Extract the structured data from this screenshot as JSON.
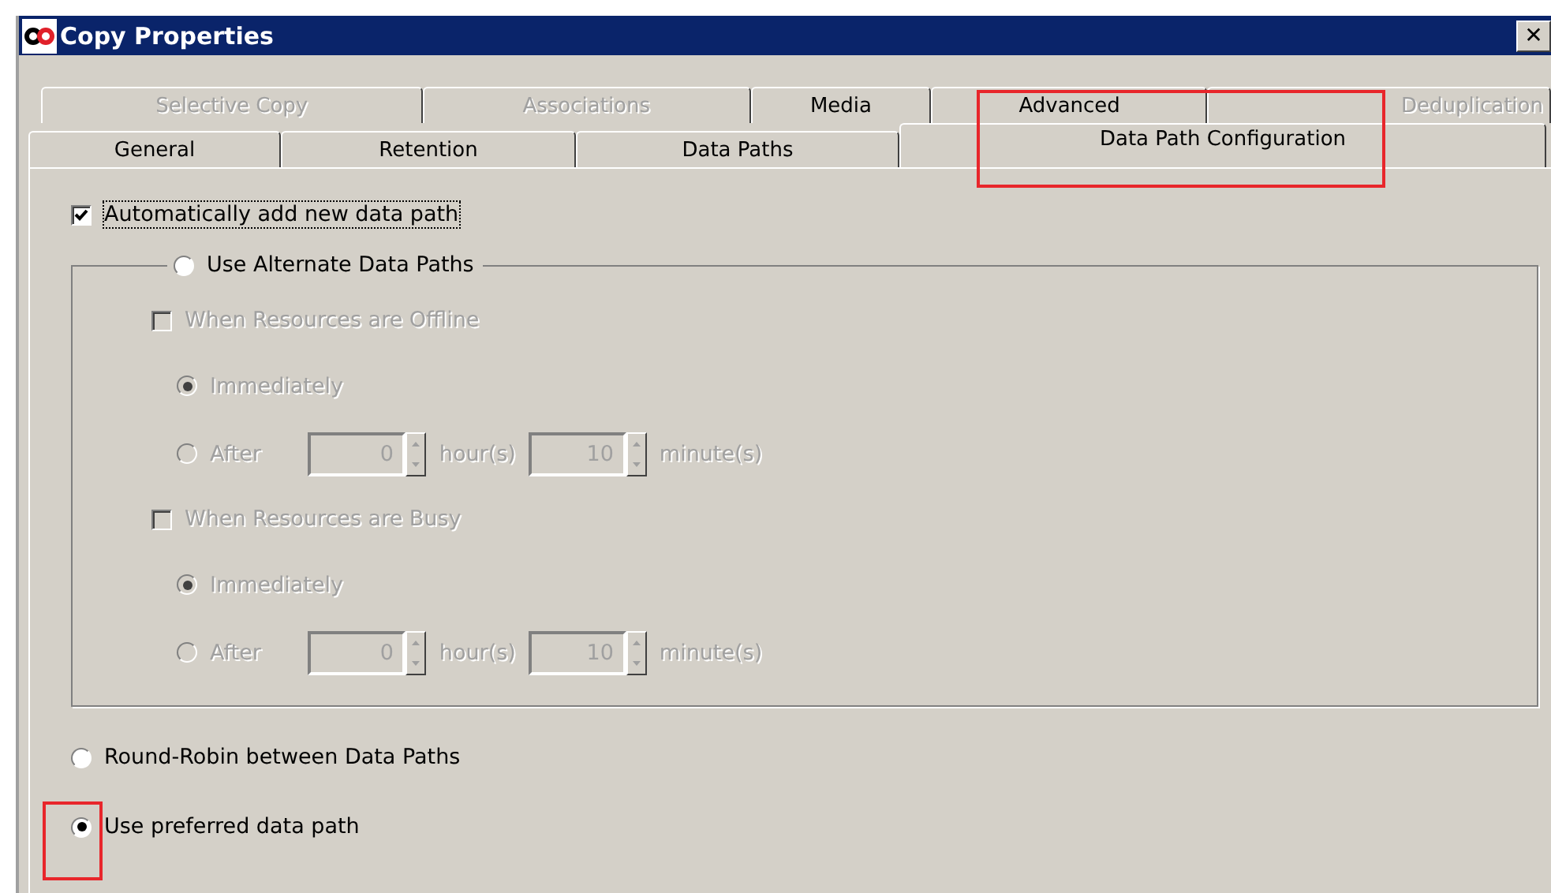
{
  "window": {
    "title": "Copy Properties",
    "close": "✕"
  },
  "tab_rows": [
    [
      {
        "label": "Selective Copy",
        "selected": false,
        "disabled": true
      },
      {
        "label": "Associations",
        "selected": false,
        "disabled": true
      },
      {
        "label": "Media",
        "selected": false,
        "disabled": false
      },
      {
        "label": "Advanced",
        "selected": false,
        "disabled": false
      },
      {
        "label": "Deduplication",
        "selected": false,
        "disabled": true
      }
    ],
    [
      {
        "label": "General",
        "selected": false,
        "disabled": false
      },
      {
        "label": "Retention",
        "selected": false,
        "disabled": false
      },
      {
        "label": "Data Paths",
        "selected": false,
        "disabled": false
      },
      {
        "label": "Data Path Configuration",
        "selected": true,
        "disabled": false,
        "highlighted": true
      }
    ]
  ],
  "auto_add": {
    "label": "Automatically add new data path",
    "checked": true
  },
  "options": [
    {
      "kind": "group",
      "label": "Use Alternate Data Paths",
      "selected": false,
      "conditions": [
        {
          "label": "When Resources are Offline",
          "checked": false,
          "disabled": true,
          "choices": [
            {
              "kind": "plain",
              "label": "Immediately",
              "selected": true
            },
            {
              "kind": "delay",
              "label": "After",
              "selected": false,
              "hours": "0",
              "hours_unit": "hour(s)",
              "minutes": "10",
              "minutes_unit": "minute(s)"
            }
          ]
        },
        {
          "label": "When Resources are Busy",
          "checked": false,
          "disabled": true,
          "choices": [
            {
              "kind": "plain",
              "label": "Immediately",
              "selected": true
            },
            {
              "kind": "delay",
              "label": "After",
              "selected": false,
              "hours": "0",
              "hours_unit": "hour(s)",
              "minutes": "10",
              "minutes_unit": "minute(s)"
            }
          ]
        }
      ]
    },
    {
      "kind": "plain",
      "label": "Round-Robin between Data Paths",
      "selected": false
    },
    {
      "kind": "plain",
      "label": "Use preferred data path",
      "selected": true,
      "highlighted": true
    }
  ]
}
